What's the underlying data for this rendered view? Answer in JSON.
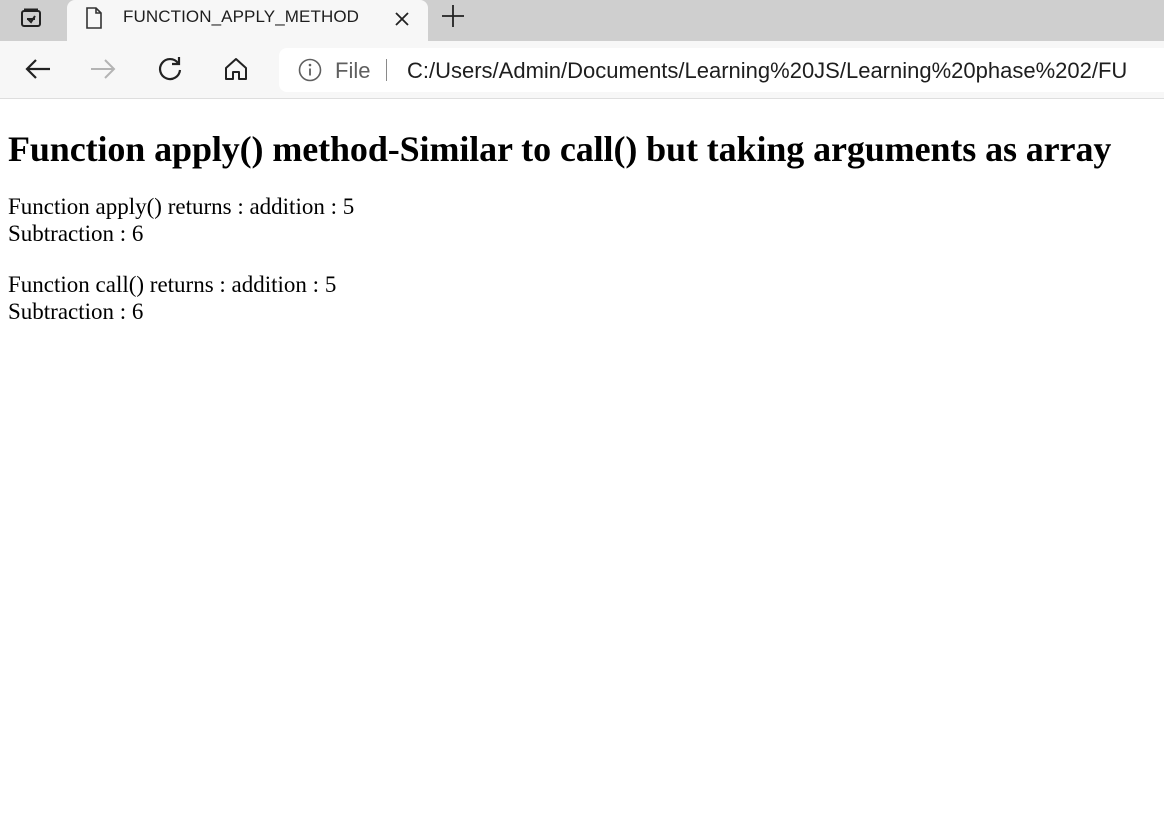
{
  "browser": {
    "tab": {
      "title": "FUNCTION_APPLY_METHOD"
    },
    "address_bar": {
      "scheme_label": "File",
      "url": "C:/Users/Admin/Documents/Learning%20JS/Learning%20phase%202/FU"
    },
    "icons": {
      "workspaces": "workspaces-icon",
      "page": "page-icon",
      "close": "close-icon",
      "new_tab": "plus-icon",
      "back": "back-arrow-icon",
      "forward": "forward-arrow-icon",
      "reload": "reload-icon",
      "home": "home-icon",
      "site_info": "info-icon"
    }
  },
  "page": {
    "heading": "Function apply() method-Similar to call() but taking arguments as array",
    "results": [
      {
        "line1": "Function apply() returns : addition : 5",
        "line2": "Subtraction : 6"
      },
      {
        "line1": "Function call() returns : addition : 5",
        "line2": "Subtraction : 6"
      }
    ]
  }
}
